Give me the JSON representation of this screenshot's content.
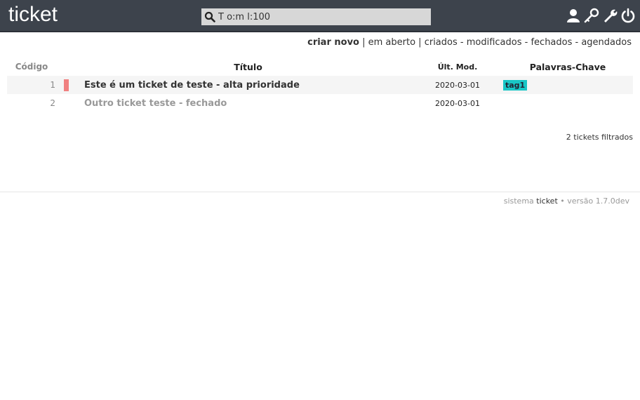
{
  "header": {
    "app_title": "ticket",
    "search": {
      "value": "T o:m l:100",
      "placeholder": ""
    },
    "icons": [
      "user-icon",
      "key-icon",
      "wrench-icon",
      "power-icon"
    ]
  },
  "nav": {
    "create_new": "criar novo",
    "sep1": " | ",
    "open": "em aberto",
    "sep2": " | ",
    "created": "criados",
    "dash1": " - ",
    "modified": "modificados",
    "dash2": " - ",
    "closed": "fechados",
    "dash3": " - ",
    "scheduled": "agendados"
  },
  "table": {
    "columns": {
      "code": "Código",
      "title": "Título",
      "last_mod": "Últ. Mod.",
      "keywords": "Palavras-Chave"
    },
    "rows": [
      {
        "code": "1",
        "priority_color": "#f08080",
        "title": "Este é um ticket de teste - alta prioridade",
        "last_mod": "2020-03-01",
        "tag": "tag1",
        "status": "open"
      },
      {
        "code": "2",
        "priority_color": "",
        "title": "Outro ticket teste - fechado",
        "last_mod": "2020-03-01",
        "tag": "",
        "status": "closed"
      }
    ]
  },
  "filter_count": "2 tickets filtrados",
  "footer": {
    "prefix": "sistema ",
    "brand": "ticket",
    "suffix": " • versão 1.7.0dev"
  },
  "colors": {
    "header_bg": "#3d434c",
    "tag_bg": "#19c6c6",
    "priority_high": "#f08080"
  }
}
